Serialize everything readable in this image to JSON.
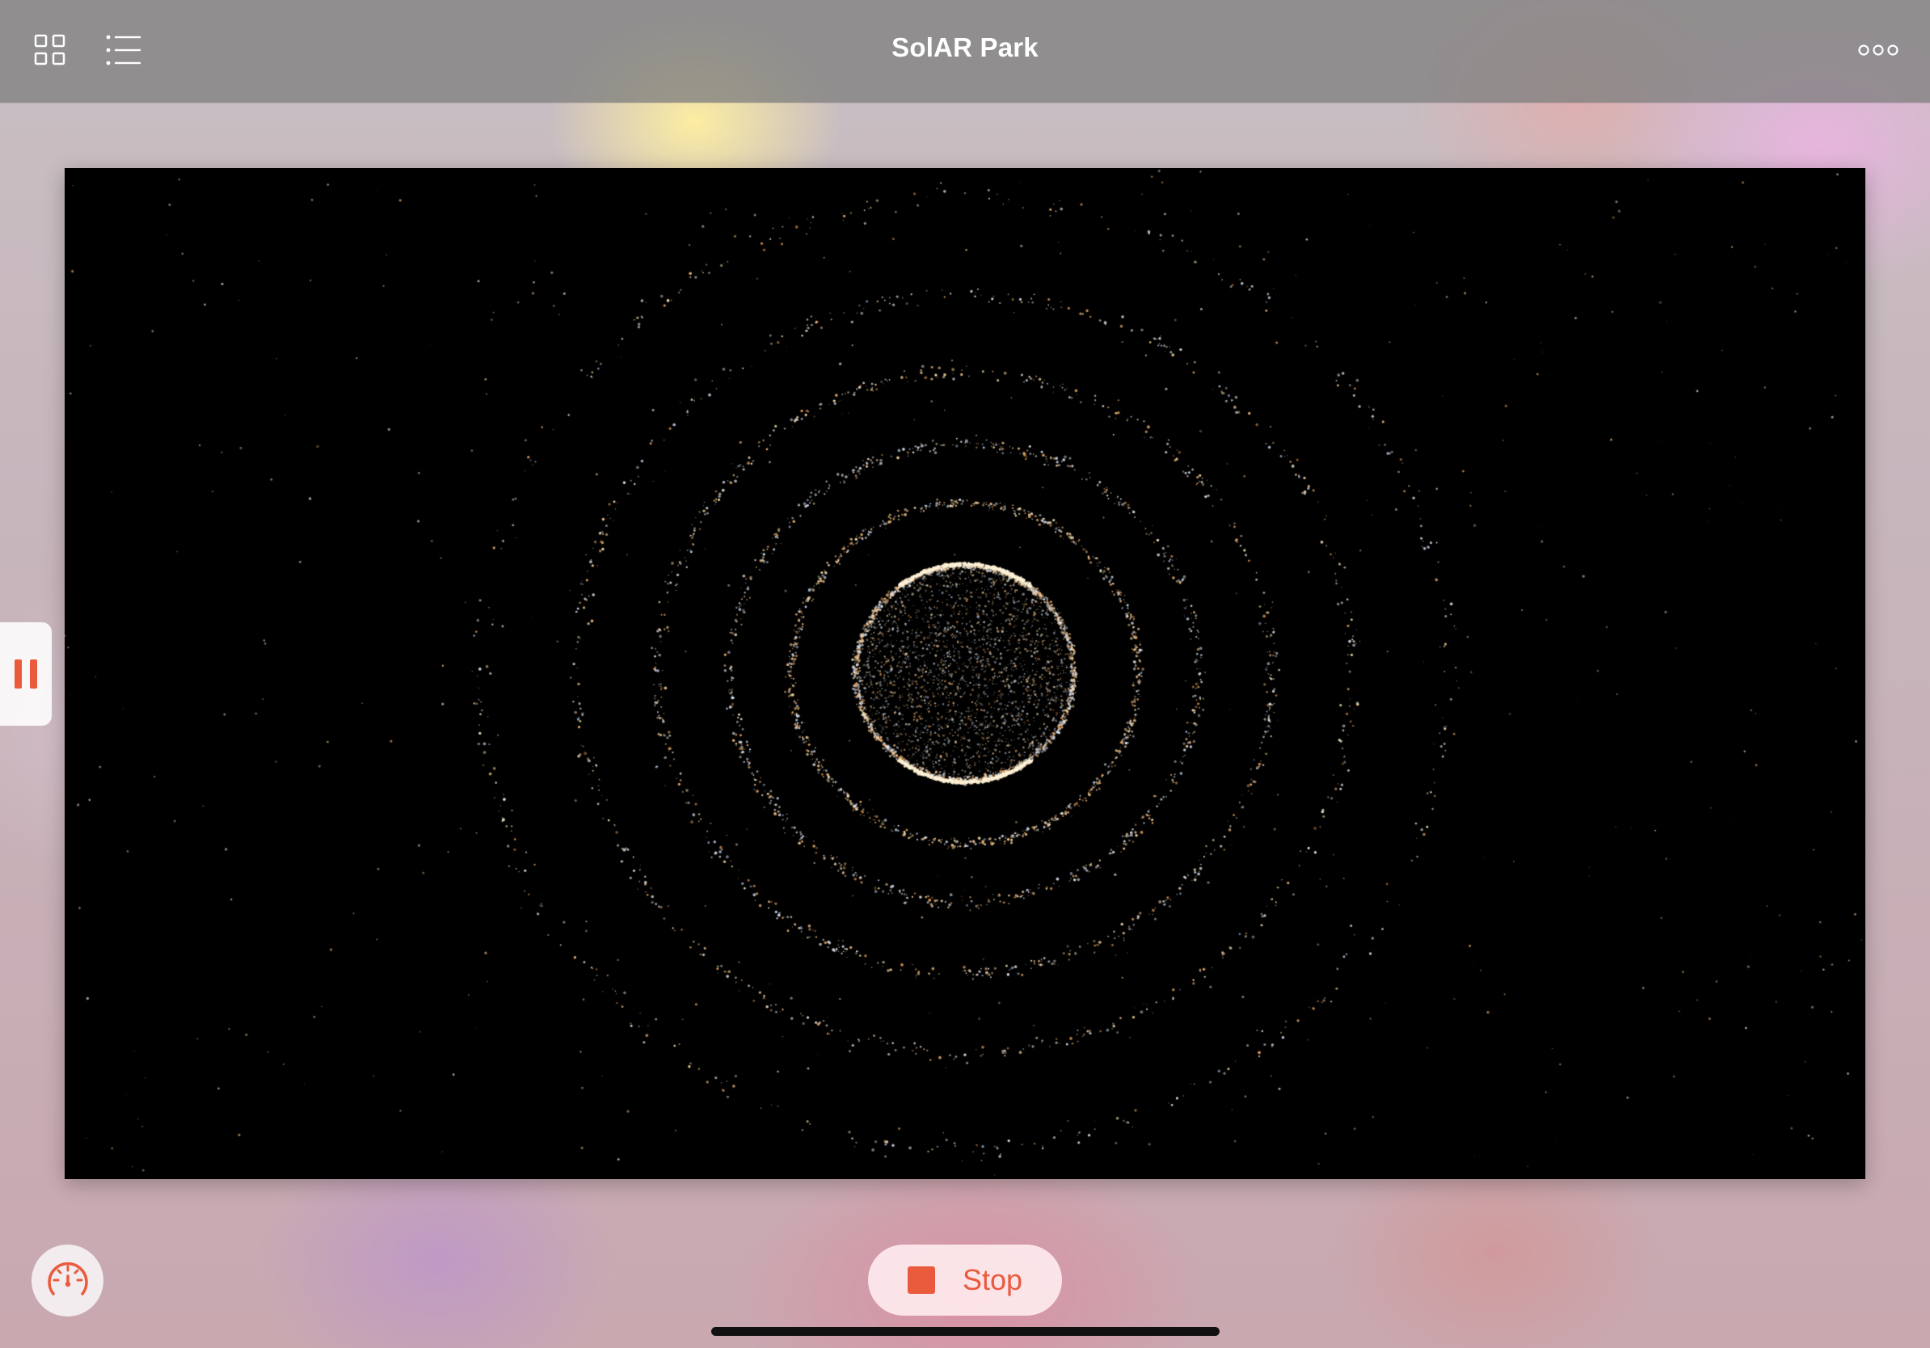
{
  "header": {
    "title": "SolAR Park",
    "grid_icon": "grid-icon",
    "list_icon": "list-icon",
    "more_icon": "ellipsis-icon"
  },
  "scene": {
    "description_icon": "particle-solar-system",
    "background": "#000000",
    "particle_colors": [
      "#f2c48a",
      "#e89a55",
      "#dfe6f2",
      "#c9a6ff"
    ]
  },
  "controls": {
    "pause_icon": "pause-icon",
    "gauge_icon": "speed-gauge-icon",
    "stop_label": "Stop",
    "stop_icon": "stop-icon"
  },
  "colors": {
    "accent": "#ea5a3d",
    "header_text": "#ffffff"
  }
}
